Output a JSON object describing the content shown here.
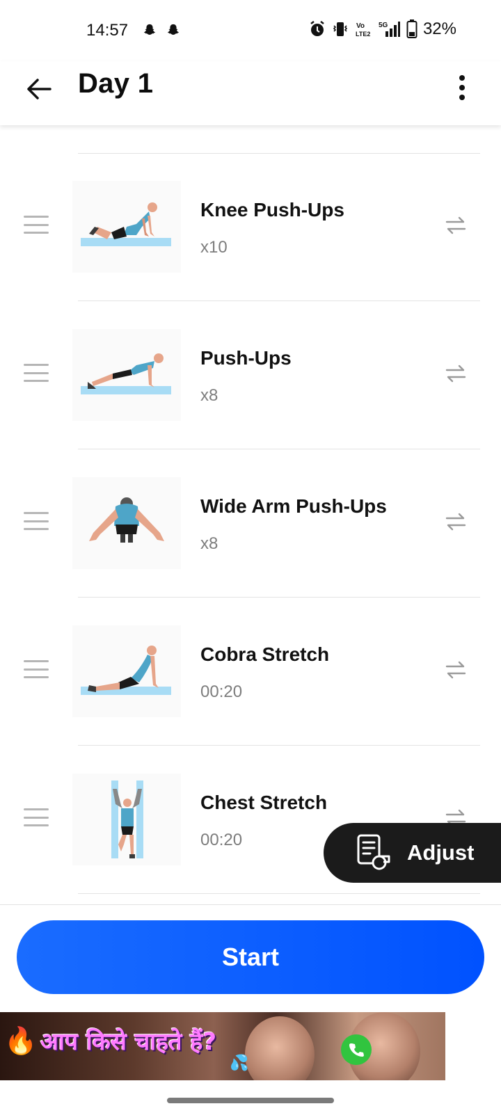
{
  "status_bar": {
    "time": "14:57",
    "icons": [
      "snapchat-icon",
      "snapchat-icon",
      "alarm-icon",
      "vibrate-icon",
      "volte-icon",
      "5g-signal-icon",
      "battery-icon"
    ],
    "battery": "32%"
  },
  "app_bar": {
    "title": "Day 1",
    "back_icon": "arrow-left-icon",
    "menu_icon": "more-vertical-icon"
  },
  "exercises": [
    {
      "name": "Knee Push-Ups",
      "value": "x10"
    },
    {
      "name": "Push-Ups",
      "value": "x8"
    },
    {
      "name": "Wide Arm Push-Ups",
      "value": "x8"
    },
    {
      "name": "Cobra Stretch",
      "value": "00:20"
    },
    {
      "name": "Chest Stretch",
      "value": "00:20"
    }
  ],
  "adjust_button": {
    "label": "Adjust",
    "icon": "checklist-whistle-icon"
  },
  "start_button": {
    "label": "Start"
  },
  "ad": {
    "text": "आप किसे चाहते हैं?"
  },
  "colors": {
    "accent": "#0055ff",
    "adjust_bg": "#1b1b1b",
    "secondary_text": "#7d7d7d"
  }
}
